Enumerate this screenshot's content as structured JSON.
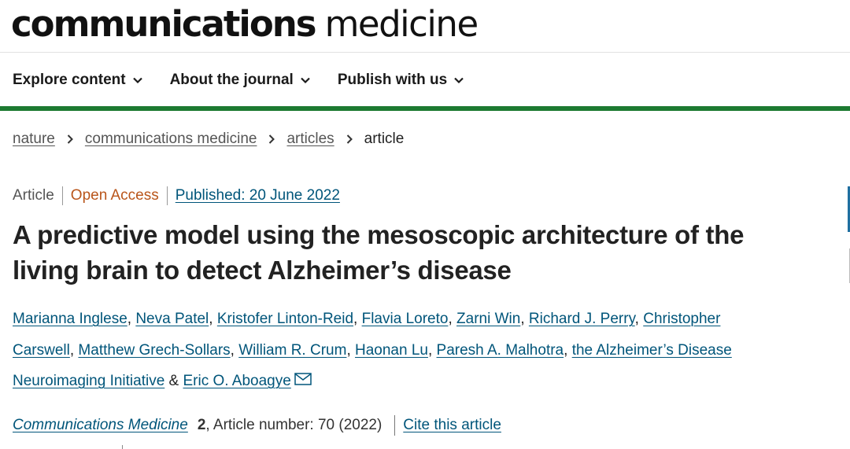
{
  "brand": {
    "bold": "communications",
    "light": "medicine"
  },
  "nav": {
    "items": [
      {
        "label": "Explore content"
      },
      {
        "label": "About the journal"
      },
      {
        "label": "Publish with us"
      }
    ]
  },
  "breadcrumb": {
    "items": [
      "nature",
      "communications medicine",
      "articles"
    ],
    "current": "article"
  },
  "meta": {
    "type": "Article",
    "access": "Open Access",
    "published": "Published: 20 June 2022"
  },
  "article": {
    "title": "A predictive model using the mesoscopic architecture of the living brain to detect Alzheimer’s disease",
    "authors": [
      "Marianna Inglese",
      "Neva Patel",
      "Kristofer Linton-Reid",
      "Flavia Loreto",
      "Zarni Win",
      "Richard J. Perry",
      "Christopher Carswell",
      "Matthew Grech-Sollars",
      "William R. Crum",
      "Haonan Lu",
      "Paresh A. Malhotra",
      "the Alzheimer’s Disease Neuroimaging Initiative",
      "Eric O. Aboagye"
    ],
    "author_sep": ", ",
    "author_last_sep": " & "
  },
  "citation": {
    "journal": "Communications Medicine",
    "volume": "2",
    "details": ", Article number: 70 (2022)",
    "cite_label": "Cite this article"
  },
  "colors": {
    "accent_green": "#1d7a31",
    "link": "#00557a",
    "open_access": "#b9551a"
  },
  "icons": [
    "chevron-down-icon",
    "chevron-right-icon",
    "mail-icon"
  ]
}
